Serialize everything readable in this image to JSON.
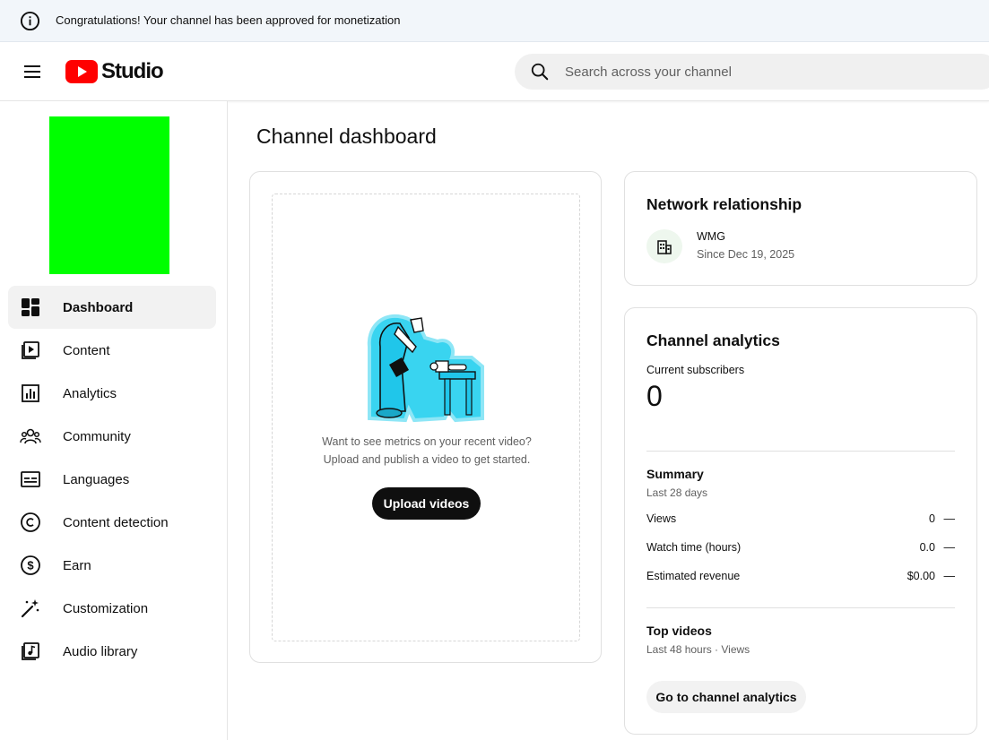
{
  "banner": {
    "icon": "info-icon",
    "text": "Congratulations! Your channel has been approved for monetization"
  },
  "header": {
    "menu_icon": "hamburger-menu-icon",
    "logo_icon": "youtube-play-icon",
    "logo_text": "Studio",
    "search": {
      "icon": "search-icon",
      "placeholder": "Search across your channel",
      "value": ""
    }
  },
  "sidebar": {
    "avatar_color": "#00ff00",
    "items": [
      {
        "label": "Dashboard",
        "icon": "dashboard-icon",
        "active": true
      },
      {
        "label": "Content",
        "icon": "content-icon",
        "active": false
      },
      {
        "label": "Analytics",
        "icon": "analytics-icon",
        "active": false
      },
      {
        "label": "Community",
        "icon": "community-icon",
        "active": false
      },
      {
        "label": "Languages",
        "icon": "languages-icon",
        "active": false
      },
      {
        "label": "Content detection",
        "icon": "copyright-icon",
        "active": false
      },
      {
        "label": "Earn",
        "icon": "dollar-icon",
        "active": false
      },
      {
        "label": "Customization",
        "icon": "magic-wand-icon",
        "active": false
      },
      {
        "label": "Audio library",
        "icon": "audio-library-icon",
        "active": false
      }
    ]
  },
  "main": {
    "title": "Channel dashboard",
    "empty_card": {
      "text_line1": "Want to see metrics on your recent video?",
      "text_line2": "Upload and publish a video to get started.",
      "button": "Upload videos"
    },
    "network": {
      "title": "Network relationship",
      "name": "WMG",
      "since": "Since Dec 19, 2025"
    },
    "analytics": {
      "title": "Channel analytics",
      "subscribers_label": "Current subscribers",
      "subscribers": "0",
      "summary_title": "Summary",
      "summary_period": "Last 28 days",
      "rows": [
        {
          "label": "Views",
          "value": "0",
          "trend": "—"
        },
        {
          "label": "Watch time (hours)",
          "value": "0.0",
          "trend": "—"
        },
        {
          "label": "Estimated revenue",
          "value": "$0.00",
          "trend": "—"
        }
      ],
      "top_videos_title": "Top videos",
      "top_videos_sub": "Last 48 hours · Views",
      "button": "Go to channel analytics"
    }
  },
  "colors": {
    "accent_red": "#ff0000",
    "illustration_cyan": "#39d4f0",
    "banner_bg": "#f2f6fa"
  }
}
